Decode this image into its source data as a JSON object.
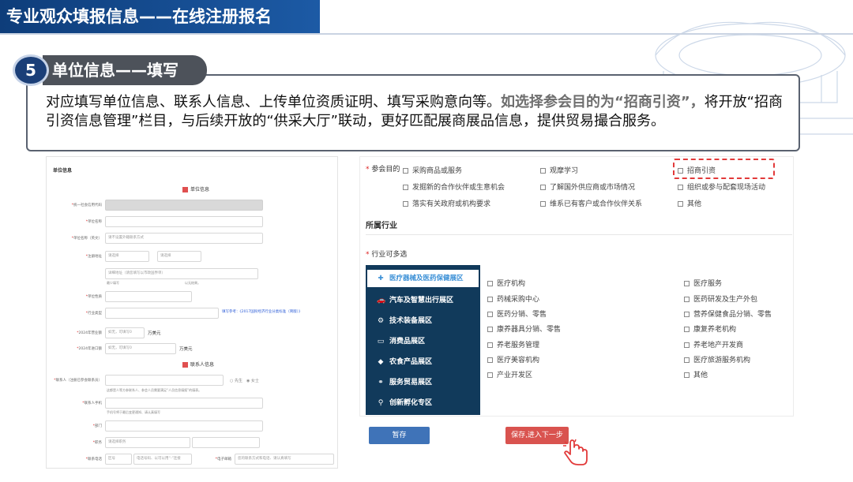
{
  "header": {
    "title": "专业观众填报信息——在线注册报名"
  },
  "step": {
    "number": "5",
    "title": "单位信息——填写",
    "text_plain": "对应填写单位信息、联系人信息、上传单位资质证明、填写采购意向等。",
    "text_highlight": "如选择参会目的为“招商引资”，",
    "text_rest": "将开放“招商引资信息管理”栏目，与后续开放的“供采大厅”联动，更好匹配展商展品信息，提供贸易撮合服务。"
  },
  "left_form": {
    "heading": "单位信息",
    "section_unit": "单位信息",
    "section_contact": "联系人信息",
    "fields": [
      {
        "label": "统一社会信用代码",
        "required": true
      },
      {
        "label": "单位名称",
        "required": true
      },
      {
        "label": "单位名称（英文）",
        "required": true,
        "placeholder": "请不设置外籍联系方式"
      },
      {
        "label": "注册地址",
        "required": true,
        "select1": "请选择",
        "select2": "请选择"
      },
      {
        "label": "",
        "placeholder": "详细地址（请您填写以市政国界单）"
      },
      {
        "label": "单位性质",
        "required": true
      },
      {
        "label": "行业类型",
        "required": true
      },
      {
        "label": "2024年营业额",
        "required": true,
        "placeholder": "如无，可填写0",
        "unit": "万美元"
      },
      {
        "label": "2024年进口额",
        "required": true,
        "placeholder": "如无，可填写0",
        "unit": "万美元"
      }
    ],
    "address_note1": "最少填写",
    "address_note2": "以无结果。",
    "industry_link": "填写参考：《2017国民经济行业分类标准（简版）》",
    "contact_fields": [
      {
        "label": "联系人（注册已参会联系员）",
        "required": true,
        "radio1": "先生",
        "radio2": "女士",
        "note": "这都是人等方参联系人、参会人员需要满足“人员信息填报”的填表。"
      },
      {
        "label": "联系人手机",
        "required": true,
        "note": "手机号将于最后变更通知、请认真填写"
      },
      {
        "label": "部门",
        "required": true
      },
      {
        "label": "职务",
        "required": true,
        "placeholder": "请选择职务"
      },
      {
        "label": "联系电话",
        "required": true,
        "ph1": "区号",
        "ph2": "电话号码、以可以用“-”连接",
        "email_label": "电子邮箱",
        "email_ph": "您的联系方式和电话、请认真填写"
      }
    ]
  },
  "purpose": {
    "label": "参会目的",
    "options": [
      "采购商品或服务",
      "观摩学习",
      "招商引资",
      "发掘新的合作伙伴或生意机会",
      "了解国外供应商或市场情况",
      "组织或参与配套现场活动",
      "落实有关政府或机构要求",
      "维系已有客户或合作伙伴关系",
      "其他"
    ]
  },
  "industry": {
    "section_title": "所属行业",
    "label": "行业可多选",
    "categories": [
      {
        "label": "医疗器械及医药保健展区",
        "icon": "medical-icon",
        "active": true
      },
      {
        "label": "汽车及智慧出行展区",
        "icon": "car-icon"
      },
      {
        "label": "技术装备展区",
        "icon": "gear-icon"
      },
      {
        "label": "消费品展区",
        "icon": "monitor-icon"
      },
      {
        "label": "农食产品展区",
        "icon": "food-icon"
      },
      {
        "label": "服务贸易展区",
        "icon": "service-icon"
      },
      {
        "label": "创新孵化专区",
        "icon": "location-icon"
      }
    ],
    "col1": [
      "医疗机构",
      "药械采购中心",
      "医药分销、零售",
      "康养器具分销、零售",
      "养老服务管理",
      "医疗美容机构",
      "产业开发区"
    ],
    "col2": [
      "医疗服务",
      "医药研发及生产外包",
      "营养保健食品分销、零售",
      "康复养老机构",
      "养老地产开发商",
      "医疗旅游服务机构",
      "其他"
    ]
  },
  "buttons": {
    "save": "暂存",
    "next": "保存,进入下一步"
  },
  "colors": {
    "title_bar": "#1c5aa5",
    "menu_bg": "#113a5b",
    "save": "#3f73b8",
    "next": "#d9534f",
    "highlight_box": "#e23a3a"
  }
}
